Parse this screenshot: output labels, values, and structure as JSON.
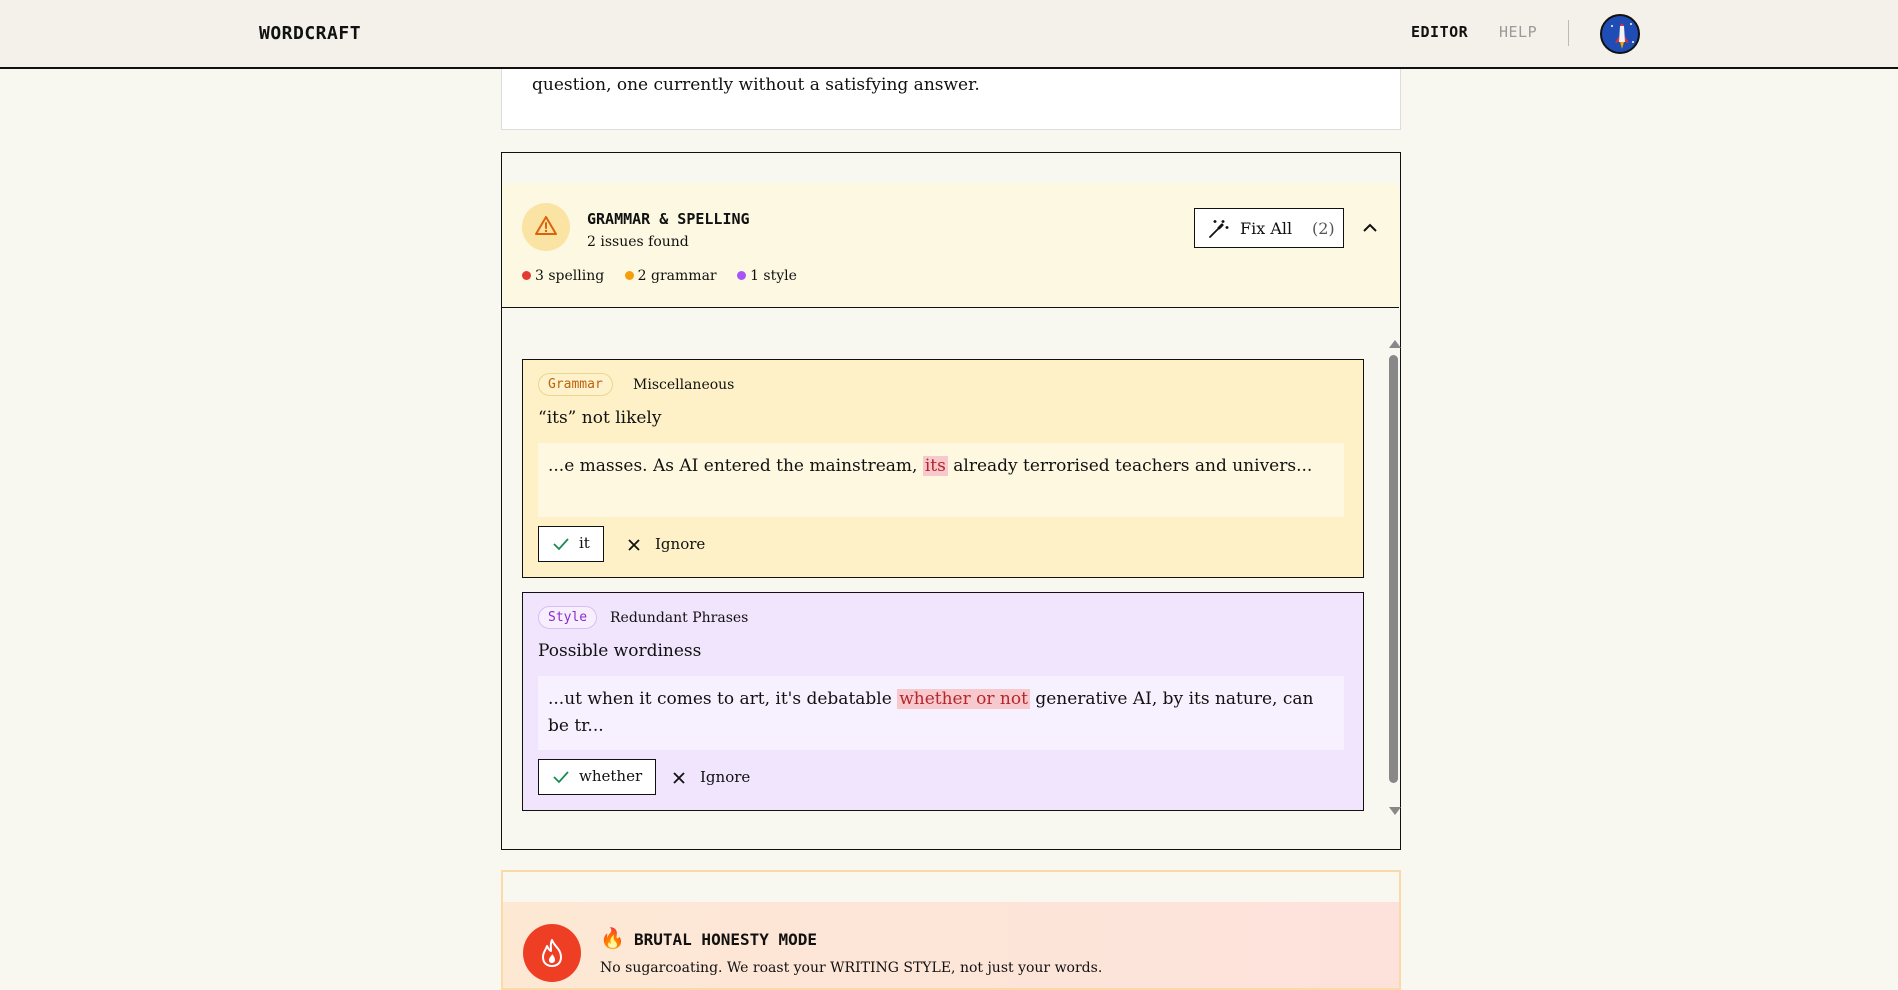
{
  "header": {
    "logo": "WORDCRAFT",
    "nav": {
      "editor": "EDITOR",
      "help": "HELP"
    }
  },
  "previous_card": {
    "text": "question, one currently without a satisfying answer."
  },
  "grammar_panel": {
    "title": "GRAMMAR & SPELLING",
    "subtitle": "2 issues found",
    "fix_all_label": "Fix All",
    "fix_all_count": "(2)",
    "counts": [
      {
        "label": "3 spelling",
        "color": "#e53935"
      },
      {
        "label": "2 grammar",
        "color": "#f59e0b"
      },
      {
        "label": "1 style",
        "color": "#a855f7"
      }
    ],
    "issues": [
      {
        "tag": "Grammar",
        "category": "Miscellaneous",
        "title": "“its” not likely",
        "context_before": "...e masses. As AI entered the mainstream, ",
        "context_highlight": "its",
        "context_after": " already terrorised teachers and univers...",
        "suggestion": "it",
        "ignore_label": "Ignore"
      },
      {
        "tag": "Style",
        "category": "Redundant Phrases",
        "title": "Possible wordiness",
        "context_before": "...ut when it comes to art, it's debatable ",
        "context_highlight": "whether or not",
        "context_after": " generative AI, by its nature, can be tr...",
        "suggestion": "whether",
        "ignore_label": "Ignore"
      }
    ]
  },
  "honesty": {
    "emoji": "🔥",
    "title": "BRUTAL HONESTY MODE",
    "subtitle": "No sugarcoating. We roast your WRITING STYLE, not just your words."
  },
  "colors": {
    "background": "#f8f8f1",
    "grammar_card": "#fef1c7",
    "style_card": "#f1e4fd",
    "highlight": "#f8c9cc",
    "accent_fire": "#ee3f25"
  }
}
